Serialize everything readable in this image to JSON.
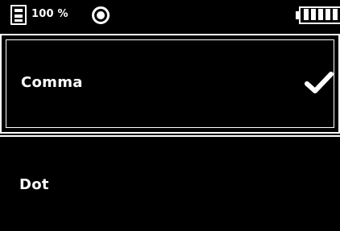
{
  "status_bar": {
    "storage_icon": "storage-card-icon",
    "storage_value": "100 %",
    "record_icon": "record-indicator-icon",
    "battery_icon": "battery-full-icon",
    "battery_level": 1.0
  },
  "options": [
    {
      "label": "Comma",
      "selected": true,
      "selected_icon": "checkmark-icon"
    },
    {
      "label": "Dot",
      "selected": false
    }
  ],
  "colors": {
    "background": "#000000",
    "foreground": "#ffffff"
  }
}
